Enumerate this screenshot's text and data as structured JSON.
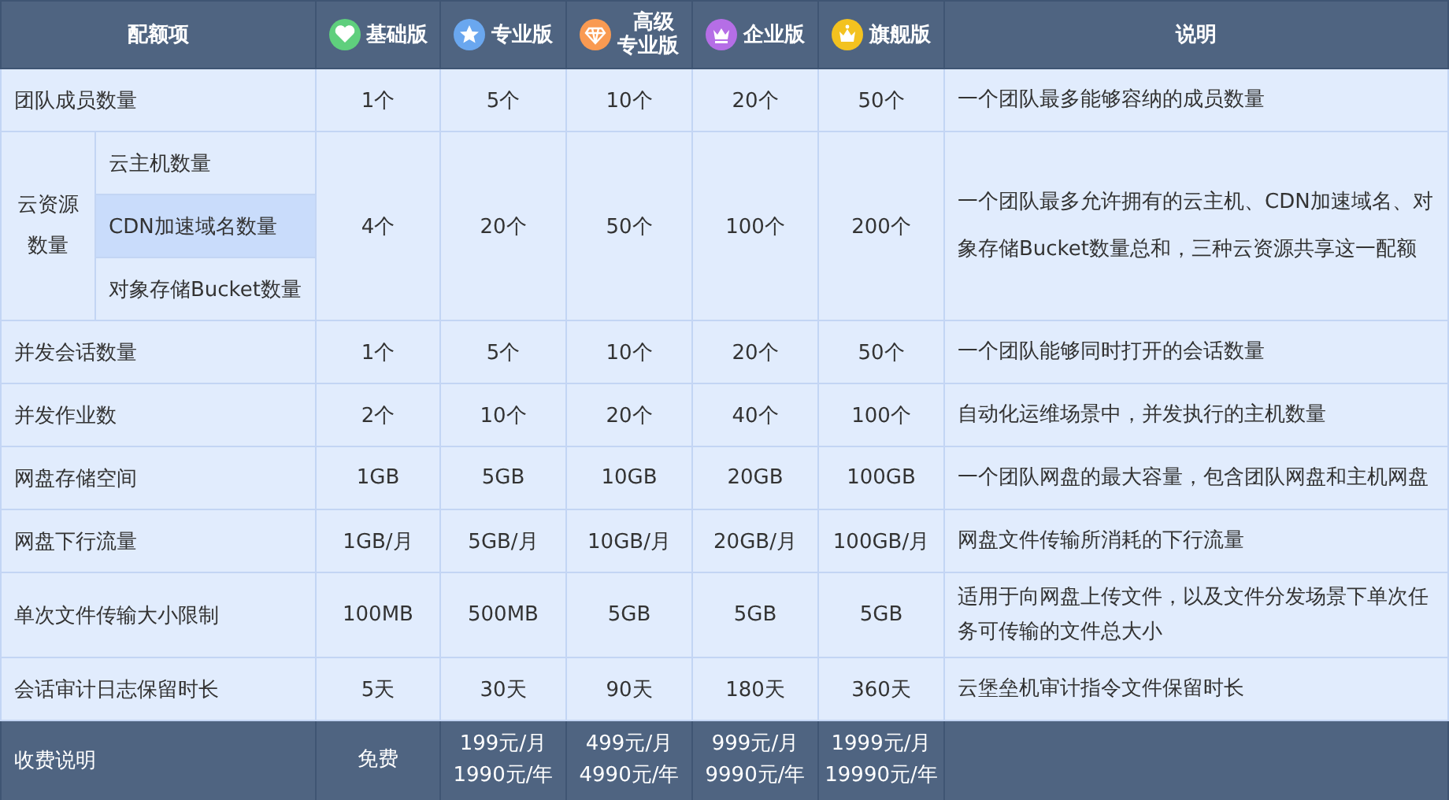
{
  "header": {
    "item": "配额项",
    "note": "说明"
  },
  "editions": [
    {
      "label": "基础版",
      "kind": "heart",
      "color": "#5fcf7d"
    },
    {
      "label": "专业版",
      "kind": "star",
      "color": "#6aa7ef"
    },
    {
      "label": "高级专业版",
      "kind": "diamond",
      "color": "#f99a52"
    },
    {
      "label": "企业版",
      "kind": "crown",
      "color": "#b56ee6"
    },
    {
      "label": "旗舰版",
      "kind": "king",
      "color": "#f3c21f"
    }
  ],
  "rows": [
    {
      "kind": "simple",
      "label": "团队成员数量",
      "values": [
        "1个",
        "5个",
        "10个",
        "20个",
        "50个"
      ],
      "note": "一个团队最多能够容纳的成员数量"
    },
    {
      "kind": "group",
      "label": "云资源数量",
      "items": [
        {
          "label": "云主机数量",
          "selected": false
        },
        {
          "label": "CDN加速域名数量",
          "selected": true
        },
        {
          "label": "对象存储Bucket数量",
          "selected": false
        }
      ],
      "values": [
        "4个",
        "20个",
        "50个",
        "100个",
        "200个"
      ],
      "note": "一个团队最多允许拥有的云主机、CDN加速域名、对象存储Bucket数量总和，三种云资源共享这一配额"
    },
    {
      "kind": "simple",
      "label": "并发会话数量",
      "values": [
        "1个",
        "5个",
        "10个",
        "20个",
        "50个"
      ],
      "note": "一个团队能够同时打开的会话数量"
    },
    {
      "kind": "simple",
      "label": "并发作业数",
      "values": [
        "2个",
        "10个",
        "20个",
        "40个",
        "100个"
      ],
      "note": "自动化运维场景中，并发执行的主机数量"
    },
    {
      "kind": "simple",
      "label": "网盘存储空间",
      "values": [
        "1GB",
        "5GB",
        "10GB",
        "20GB",
        "100GB"
      ],
      "note": "一个团队网盘的最大容量，包含团队网盘和主机网盘"
    },
    {
      "kind": "simple",
      "label": "网盘下行流量",
      "values": [
        "1GB/月",
        "5GB/月",
        "10GB/月",
        "20GB/月",
        "100GB/月"
      ],
      "note": "网盘文件传输所消耗的下行流量"
    },
    {
      "kind": "simple",
      "label": "单次文件传输大小限制",
      "values": [
        "100MB",
        "500MB",
        "5GB",
        "5GB",
        "5GB"
      ],
      "note": "适用于向网盘上传文件，以及文件分发场景下单次任务可传输的文件总大小"
    },
    {
      "kind": "simple",
      "label": "会话审计日志保留时长",
      "values": [
        "5天",
        "30天",
        "90天",
        "180天",
        "360天"
      ],
      "note": "云堡垒机审计指令文件保留时长"
    }
  ],
  "footer": {
    "label": "收费说明",
    "prices": [
      [
        "免费"
      ],
      [
        "199元/月",
        "1990元/年"
      ],
      [
        "499元/月",
        "4990元/年"
      ],
      [
        "999元/月",
        "9990元/年"
      ],
      [
        "1999元/月",
        "19990元/年"
      ]
    ]
  }
}
